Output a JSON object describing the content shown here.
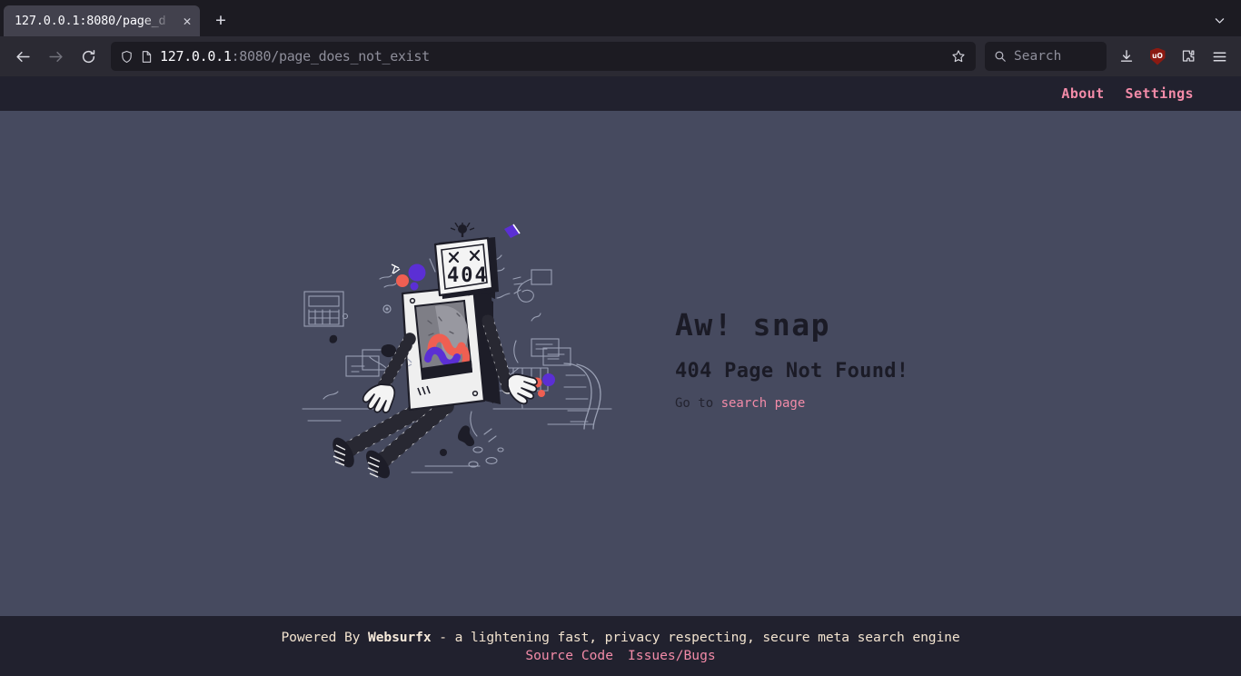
{
  "browser": {
    "tab": {
      "title": "127.0.0.1:8080/page_d",
      "close_icon": "close-icon"
    },
    "newtab_icon": "plus-icon",
    "tablist_icon": "chevron-down-icon",
    "back_icon": "arrow-left-icon",
    "forward_icon": "arrow-right-icon",
    "reload_icon": "reload-icon",
    "shield_icon": "shield-icon",
    "page_icon": "page-icon",
    "url": {
      "host": "127.0.0.1",
      "rest": ":8080/page_does_not_exist"
    },
    "bookmark_icon": "star-icon",
    "search": {
      "placeholder": "Search",
      "icon": "search-icon"
    },
    "downloads_icon": "download-icon",
    "ublock": {
      "icon": "ublock-shield-icon",
      "label": "uO"
    },
    "extensions_icon": "extensions-puzzle-icon",
    "menu_icon": "hamburger-menu-icon"
  },
  "site": {
    "nav": [
      {
        "label": "About"
      },
      {
        "label": "Settings"
      }
    ],
    "illustration": {
      "name": "broken-robot-404-illustration",
      "screen_text": "404",
      "colors": {
        "robot_light": "#f2f2f2",
        "robot_dark": "#16161f",
        "accent_red": "#ef5f52",
        "accent_purple": "#5b2fd4",
        "outline": "#9aa0b4"
      }
    },
    "error": {
      "heading": "Aw! snap",
      "subheading": "404 Page Not Found!",
      "hint_prefix": "Go to ",
      "hint_link": "search page"
    },
    "footer": {
      "prefix": "Powered By ",
      "brand": "Websurfx",
      "suffix": " - a lightening fast, privacy respecting, secure meta search engine",
      "links": [
        {
          "label": "Source Code"
        },
        {
          "label": "Issues/Bugs"
        }
      ]
    }
  },
  "colors": {
    "page_bg": "#464a5f",
    "chrome_bg": "#2b2a33",
    "nav_bg": "#21212e",
    "accent_pink": "#f38ba8",
    "footer_text": "#f2e3cf"
  }
}
